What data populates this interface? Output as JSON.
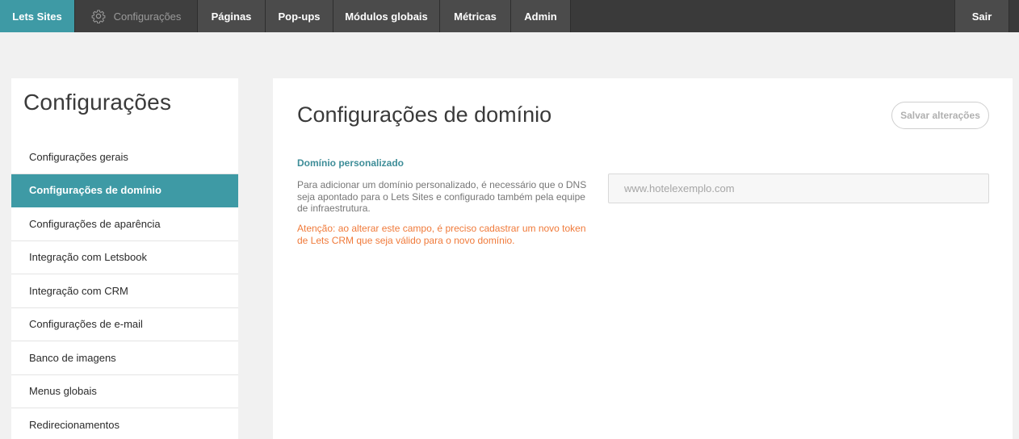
{
  "nav": {
    "brand": "Lets Sites",
    "items": [
      {
        "label": "Configurações"
      },
      {
        "label": "Páginas"
      },
      {
        "label": "Pop-ups"
      },
      {
        "label": "Módulos globais"
      },
      {
        "label": "Métricas"
      },
      {
        "label": "Admin"
      }
    ],
    "logout": "Sair"
  },
  "sidebar": {
    "title": "Configurações",
    "items": [
      {
        "label": "Configurações gerais"
      },
      {
        "label": "Configurações de domínio"
      },
      {
        "label": "Configurações de aparência"
      },
      {
        "label": "Integração com Letsbook"
      },
      {
        "label": "Integração com CRM"
      },
      {
        "label": "Configurações de e-mail"
      },
      {
        "label": "Banco de imagens"
      },
      {
        "label": "Menus globais"
      },
      {
        "label": "Redirecionamentos"
      }
    ],
    "active_index": 1
  },
  "main": {
    "title": "Configurações de domínio",
    "save_label": "Salvar alterações",
    "section_label": "Domínio personalizado",
    "description": "Para adicionar um domínio personalizado, é necessário que o DNS seja apontado para o Lets Sites e configurado também pela equipe de infraestrutura.",
    "warning": "Atenção: ao alterar este campo, é preciso cadastrar um novo token de Lets CRM que seja válido para o novo domínio.",
    "domain_input": {
      "value": "",
      "placeholder": "www.hotelexemplo.com"
    }
  },
  "colors": {
    "accent": "#3e9aa5",
    "topbar": "#3a3a3a",
    "warning": "#f07a3a",
    "section_label": "#3e8d98"
  },
  "icons": {
    "settings": "gear-icon"
  }
}
